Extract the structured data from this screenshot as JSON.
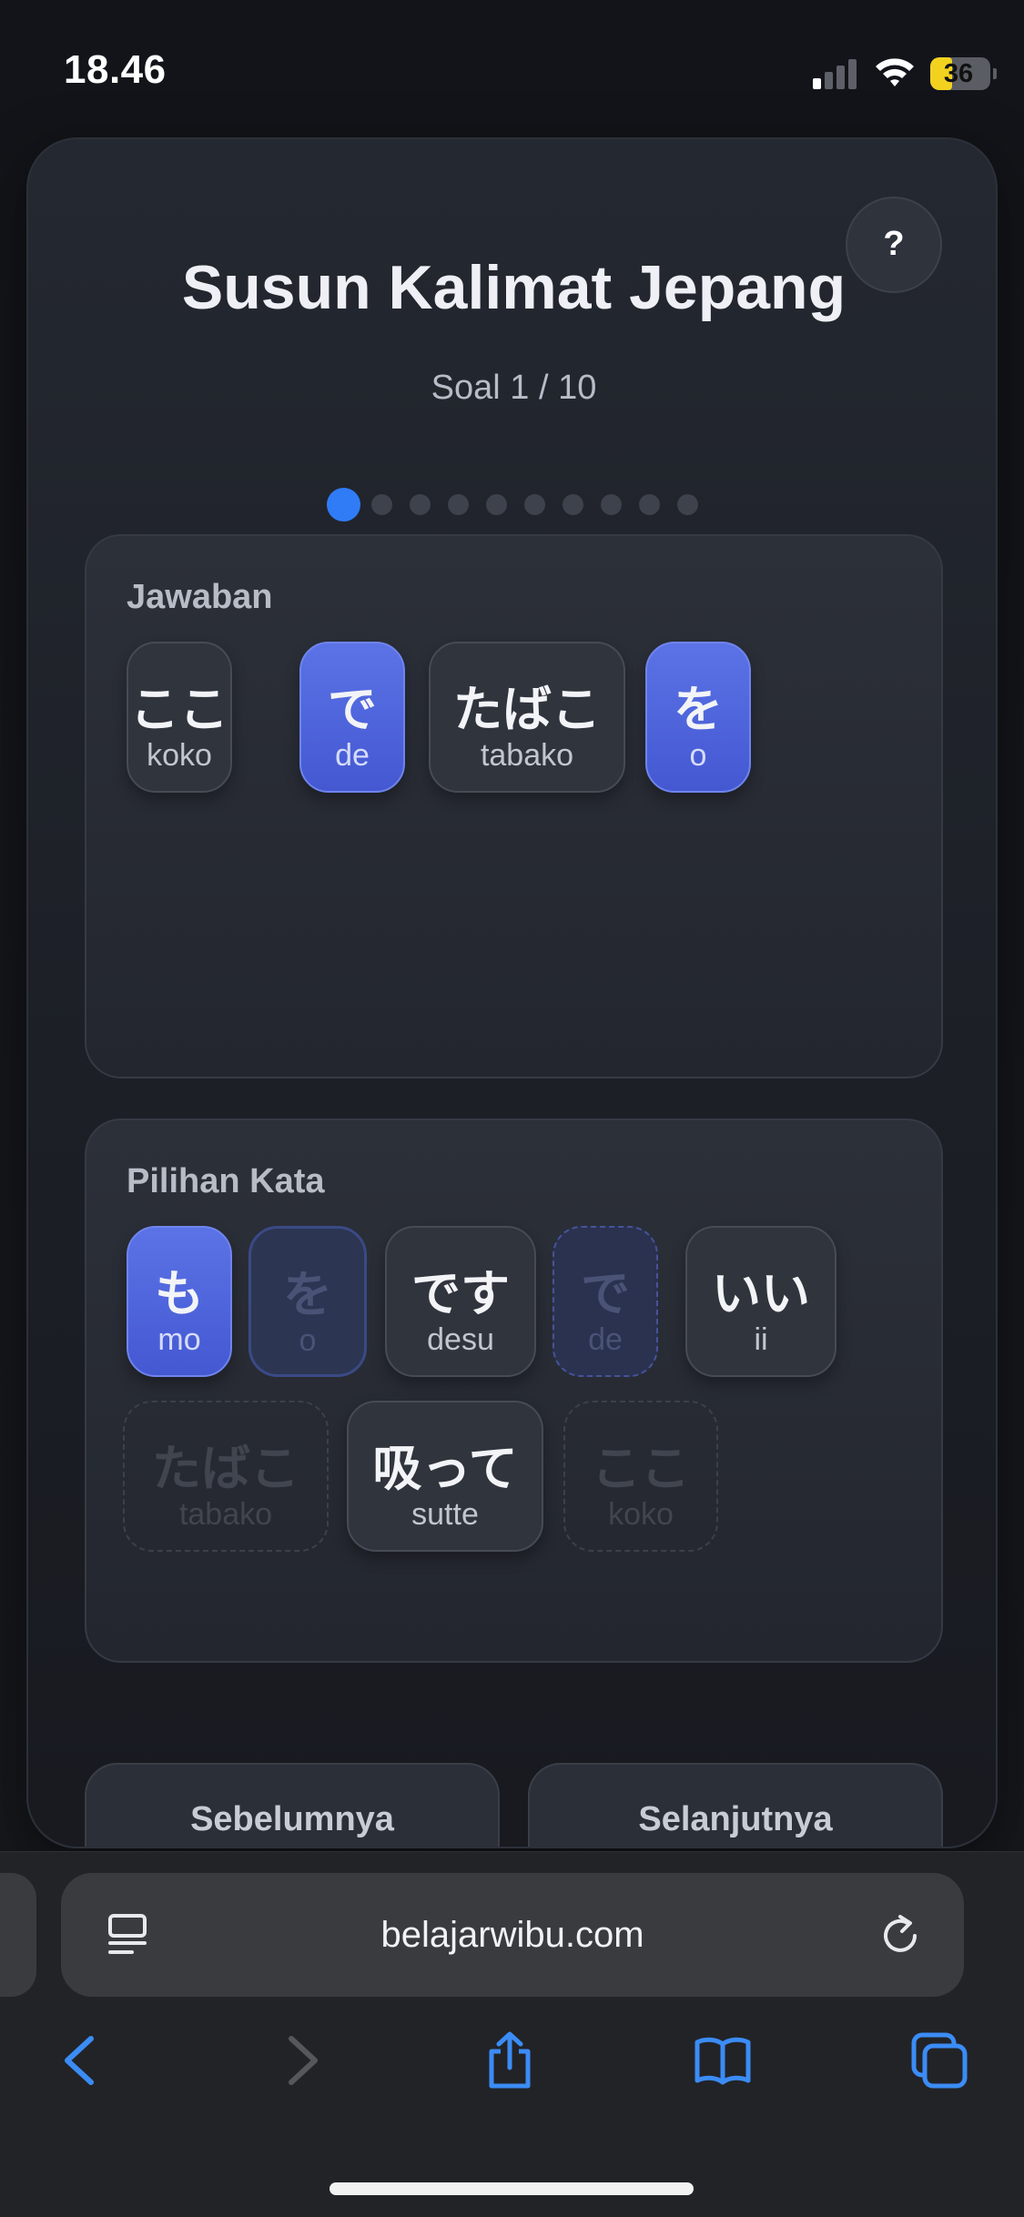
{
  "status_bar": {
    "time": "18.46",
    "battery": "36",
    "battery_level": 0.36
  },
  "app": {
    "title": "Susun Kalimat Jepang",
    "progress": "Soal 1 / 10",
    "current_question": 1,
    "total_questions": 10,
    "help_label": "?"
  },
  "answer_panel": {
    "label": "Jawaban",
    "tiles": [
      {
        "jp": "ここ",
        "romaji": "koko",
        "kind": "word"
      },
      {
        "jp": "で",
        "romaji": "de",
        "kind": "particle"
      },
      {
        "jp": "たばこ",
        "romaji": "tabako",
        "kind": "word"
      },
      {
        "jp": "を",
        "romaji": "o",
        "kind": "particle"
      }
    ]
  },
  "choices_panel": {
    "label": "Pilihan Kata",
    "tiles": [
      {
        "jp": "も",
        "romaji": "mo",
        "state": "available",
        "kind": "particle"
      },
      {
        "jp": "を",
        "romaji": "o",
        "state": "used",
        "kind": "particle"
      },
      {
        "jp": "です",
        "romaji": "desu",
        "state": "available",
        "kind": "word"
      },
      {
        "jp": "で",
        "romaji": "de",
        "state": "used",
        "kind": "particle"
      },
      {
        "jp": "いい",
        "romaji": "ii",
        "state": "available",
        "kind": "word"
      },
      {
        "jp": "たばこ",
        "romaji": "tabako",
        "state": "used",
        "kind": "word"
      },
      {
        "jp": "吸って",
        "romaji": "sutte",
        "state": "available",
        "kind": "word"
      },
      {
        "jp": "ここ",
        "romaji": "koko",
        "state": "used",
        "kind": "word"
      }
    ]
  },
  "nav": {
    "prev_label": "Sebelumnya",
    "next_label": "Selanjutnya"
  },
  "browser": {
    "url": "belajarwibu.com"
  },
  "colors": {
    "accent": "#2f7cf6",
    "particle": "#4f66dc",
    "background": "#14161b",
    "card": "#23262e"
  },
  "icons": {
    "toolbar": [
      "back-icon",
      "forward-icon",
      "share-icon",
      "bookmarks-icon",
      "tabs-icon"
    ],
    "address": [
      "reader-icon",
      "reload-icon"
    ]
  }
}
